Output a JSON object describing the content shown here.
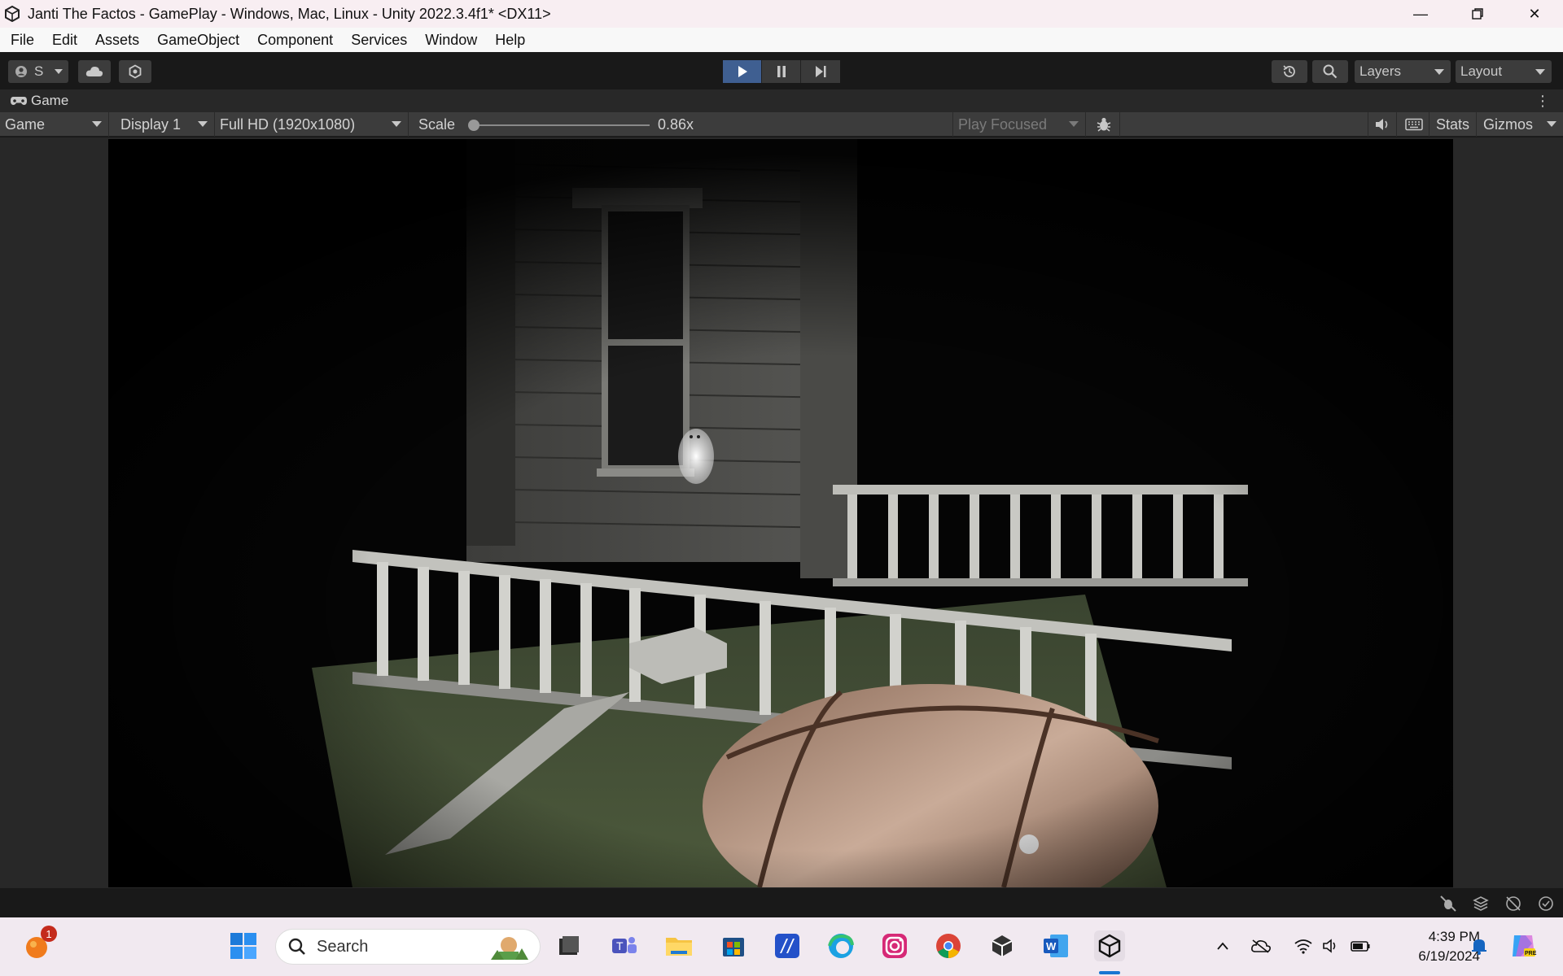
{
  "window": {
    "title": "Janti The Factos - GamePlay - Windows, Mac, Linux - Unity 2022.3.4f1* <DX11>"
  },
  "menu": [
    "File",
    "Edit",
    "Assets",
    "GameObject",
    "Component",
    "Services",
    "Window",
    "Help"
  ],
  "toolbar": {
    "account_label": "S",
    "layers_label": "Layers",
    "layout_label": "Layout"
  },
  "tab": {
    "label": "Game"
  },
  "gamebar": {
    "view_mode": "Game",
    "display": "Display 1",
    "resolution": "Full HD (1920x1080)",
    "scale_label": "Scale",
    "scale_value": "0.86x",
    "play_mode": "Play Focused",
    "stats_label": "Stats",
    "gizmos_label": "Gizmos",
    "scale_fraction": 0.0
  },
  "taskbar": {
    "search_placeholder": "Search",
    "time": "4:39 PM",
    "date": "6/19/2024",
    "notification_count": "1",
    "pinned_apps": [
      "start-icon",
      "search-icon",
      "file-manager-icon",
      "teams-icon",
      "file-explorer-icon",
      "store-icon",
      "tasks-icon",
      "edge-icon",
      "instagram-icon",
      "chrome-icon",
      "unity-hub-icon",
      "word-icon",
      "unity-icon"
    ]
  },
  "colors": {
    "play_active": "#3f5f91",
    "editor_bg": "#191919",
    "panel_bg": "#3c3c3c",
    "taskbar_bg": "#f1e9f0"
  }
}
